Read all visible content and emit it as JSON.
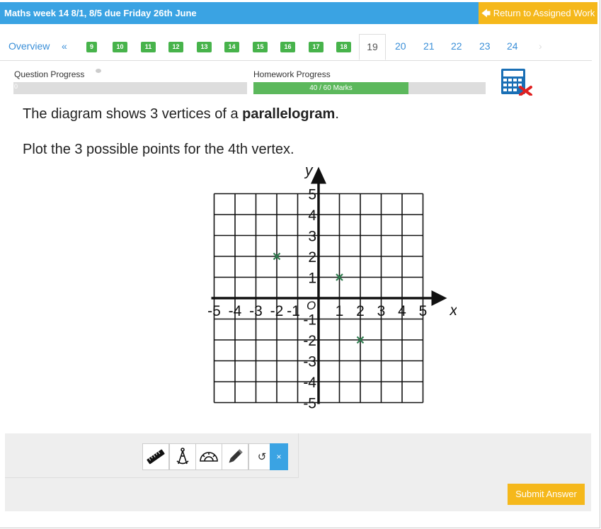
{
  "header": {
    "title": "Maths week 14 8/1, 8/5 due Friday 26th June",
    "return_label": "Return to Assigned Work"
  },
  "tabs": {
    "overview": "Overview",
    "prev": "«",
    "done": [
      "9",
      "10",
      "11",
      "12",
      "13",
      "14",
      "15",
      "16",
      "17",
      "18"
    ],
    "active": "19",
    "upcoming": [
      "20",
      "21",
      "22",
      "23",
      "24"
    ],
    "next": "›"
  },
  "progress": {
    "question_label": "Question Progress",
    "question_value": "0",
    "question_fraction": 0,
    "homework_label": "Homework Progress",
    "homework_text": "40 / 60 Marks",
    "homework_fraction": 0.667
  },
  "question": {
    "line1_pre": "The diagram shows 3 vertices of a ",
    "line1_bold": "parallelogram",
    "line1_post": ".",
    "line2": "Plot the 3 possible points for the 4th vertex."
  },
  "graph": {
    "x_axis_label": "x",
    "y_axis_label": "y",
    "origin_label": "O",
    "x_ticks": [
      "-5",
      "-4",
      "-3",
      "-2",
      "-1",
      "1",
      "2",
      "3",
      "4",
      "5"
    ],
    "y_ticks": [
      "5",
      "4",
      "3",
      "2",
      "1",
      "-1",
      "-2",
      "-3",
      "-4",
      "-5"
    ],
    "range": [
      -5,
      5
    ],
    "points": [
      {
        "x": -2,
        "y": 2
      },
      {
        "x": 1,
        "y": 1
      },
      {
        "x": 2,
        "y": -2
      }
    ],
    "point_color": "#2e7d4f"
  },
  "tools": {
    "items": [
      "ruler-icon",
      "compass-icon",
      "protractor-icon",
      "pencil-icon",
      "undo-icon",
      "close-icon"
    ],
    "undo_symbol": "↺",
    "close_symbol": "×"
  },
  "submit_label": "Submit Answer",
  "colors": {
    "brand_blue": "#3aa3e3",
    "accent_orange": "#f5b81b",
    "success_green": "#5cb85c"
  }
}
